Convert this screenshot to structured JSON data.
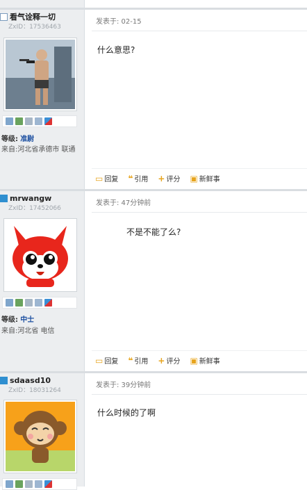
{
  "posts": [
    {
      "username": "看气诠释一切",
      "zxid": "ZxID：17536463",
      "level_label": "等级:",
      "rank": "准尉",
      "location": "来自:河北省承德市 联通",
      "posted": "发表于: 02-15",
      "content": "什么意思?"
    },
    {
      "username": "mrwangw",
      "zxid": "ZxID：17452066",
      "level_label": "等级:",
      "rank": "中士",
      "location": "来自:河北省 电信",
      "posted": "发表于: 47分钟前",
      "content": "不是不能了么?"
    },
    {
      "username": "sdaasd10",
      "zxid": "ZxID：18031264",
      "posted": "发表于: 39分钟前",
      "content": "什么时候的了啊"
    }
  ],
  "actions": {
    "reply": "回复",
    "quote": "引用",
    "rate": "评分",
    "news": "新鲜事"
  },
  "icons": [
    "mail-icon",
    "add-friend-icon",
    "profile-icon",
    "photo-icon",
    "blocks-icon"
  ]
}
